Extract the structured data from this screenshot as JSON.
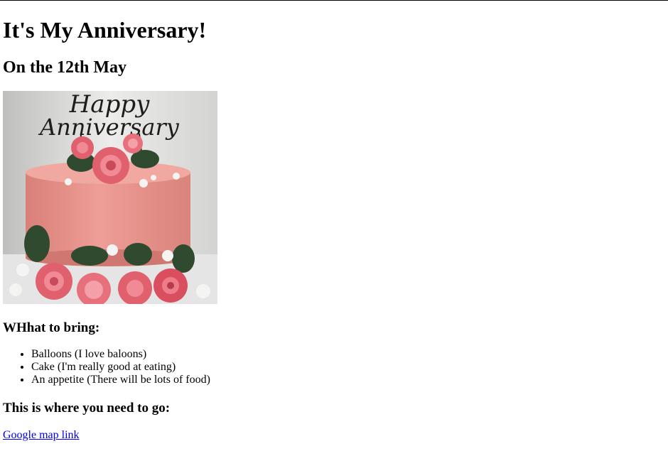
{
  "page": {
    "title": "It's My Anniversary!",
    "subtitle": "On the 12th May",
    "image": {
      "icon": "anniversary-cake-photo",
      "cake_topper_text": "Happy Anniversary",
      "colors": {
        "background": "#e4e4e2",
        "cake": "#e9968f",
        "rose": "#e0606e",
        "leaf": "#2f4a2e",
        "topper": "#1d1d1d"
      }
    },
    "bring_heading": "WHhat to bring:",
    "bring_items": [
      "Balloons (I love baloons)",
      "Cake (I'm really good at eating)",
      "An appetite (There will be lots of food)"
    ],
    "go_heading": "This is where you need to go:",
    "map_link": "Google map link"
  },
  "colors": {
    "link": "#0000ee",
    "text": "#000000",
    "background": "#ffffff"
  }
}
